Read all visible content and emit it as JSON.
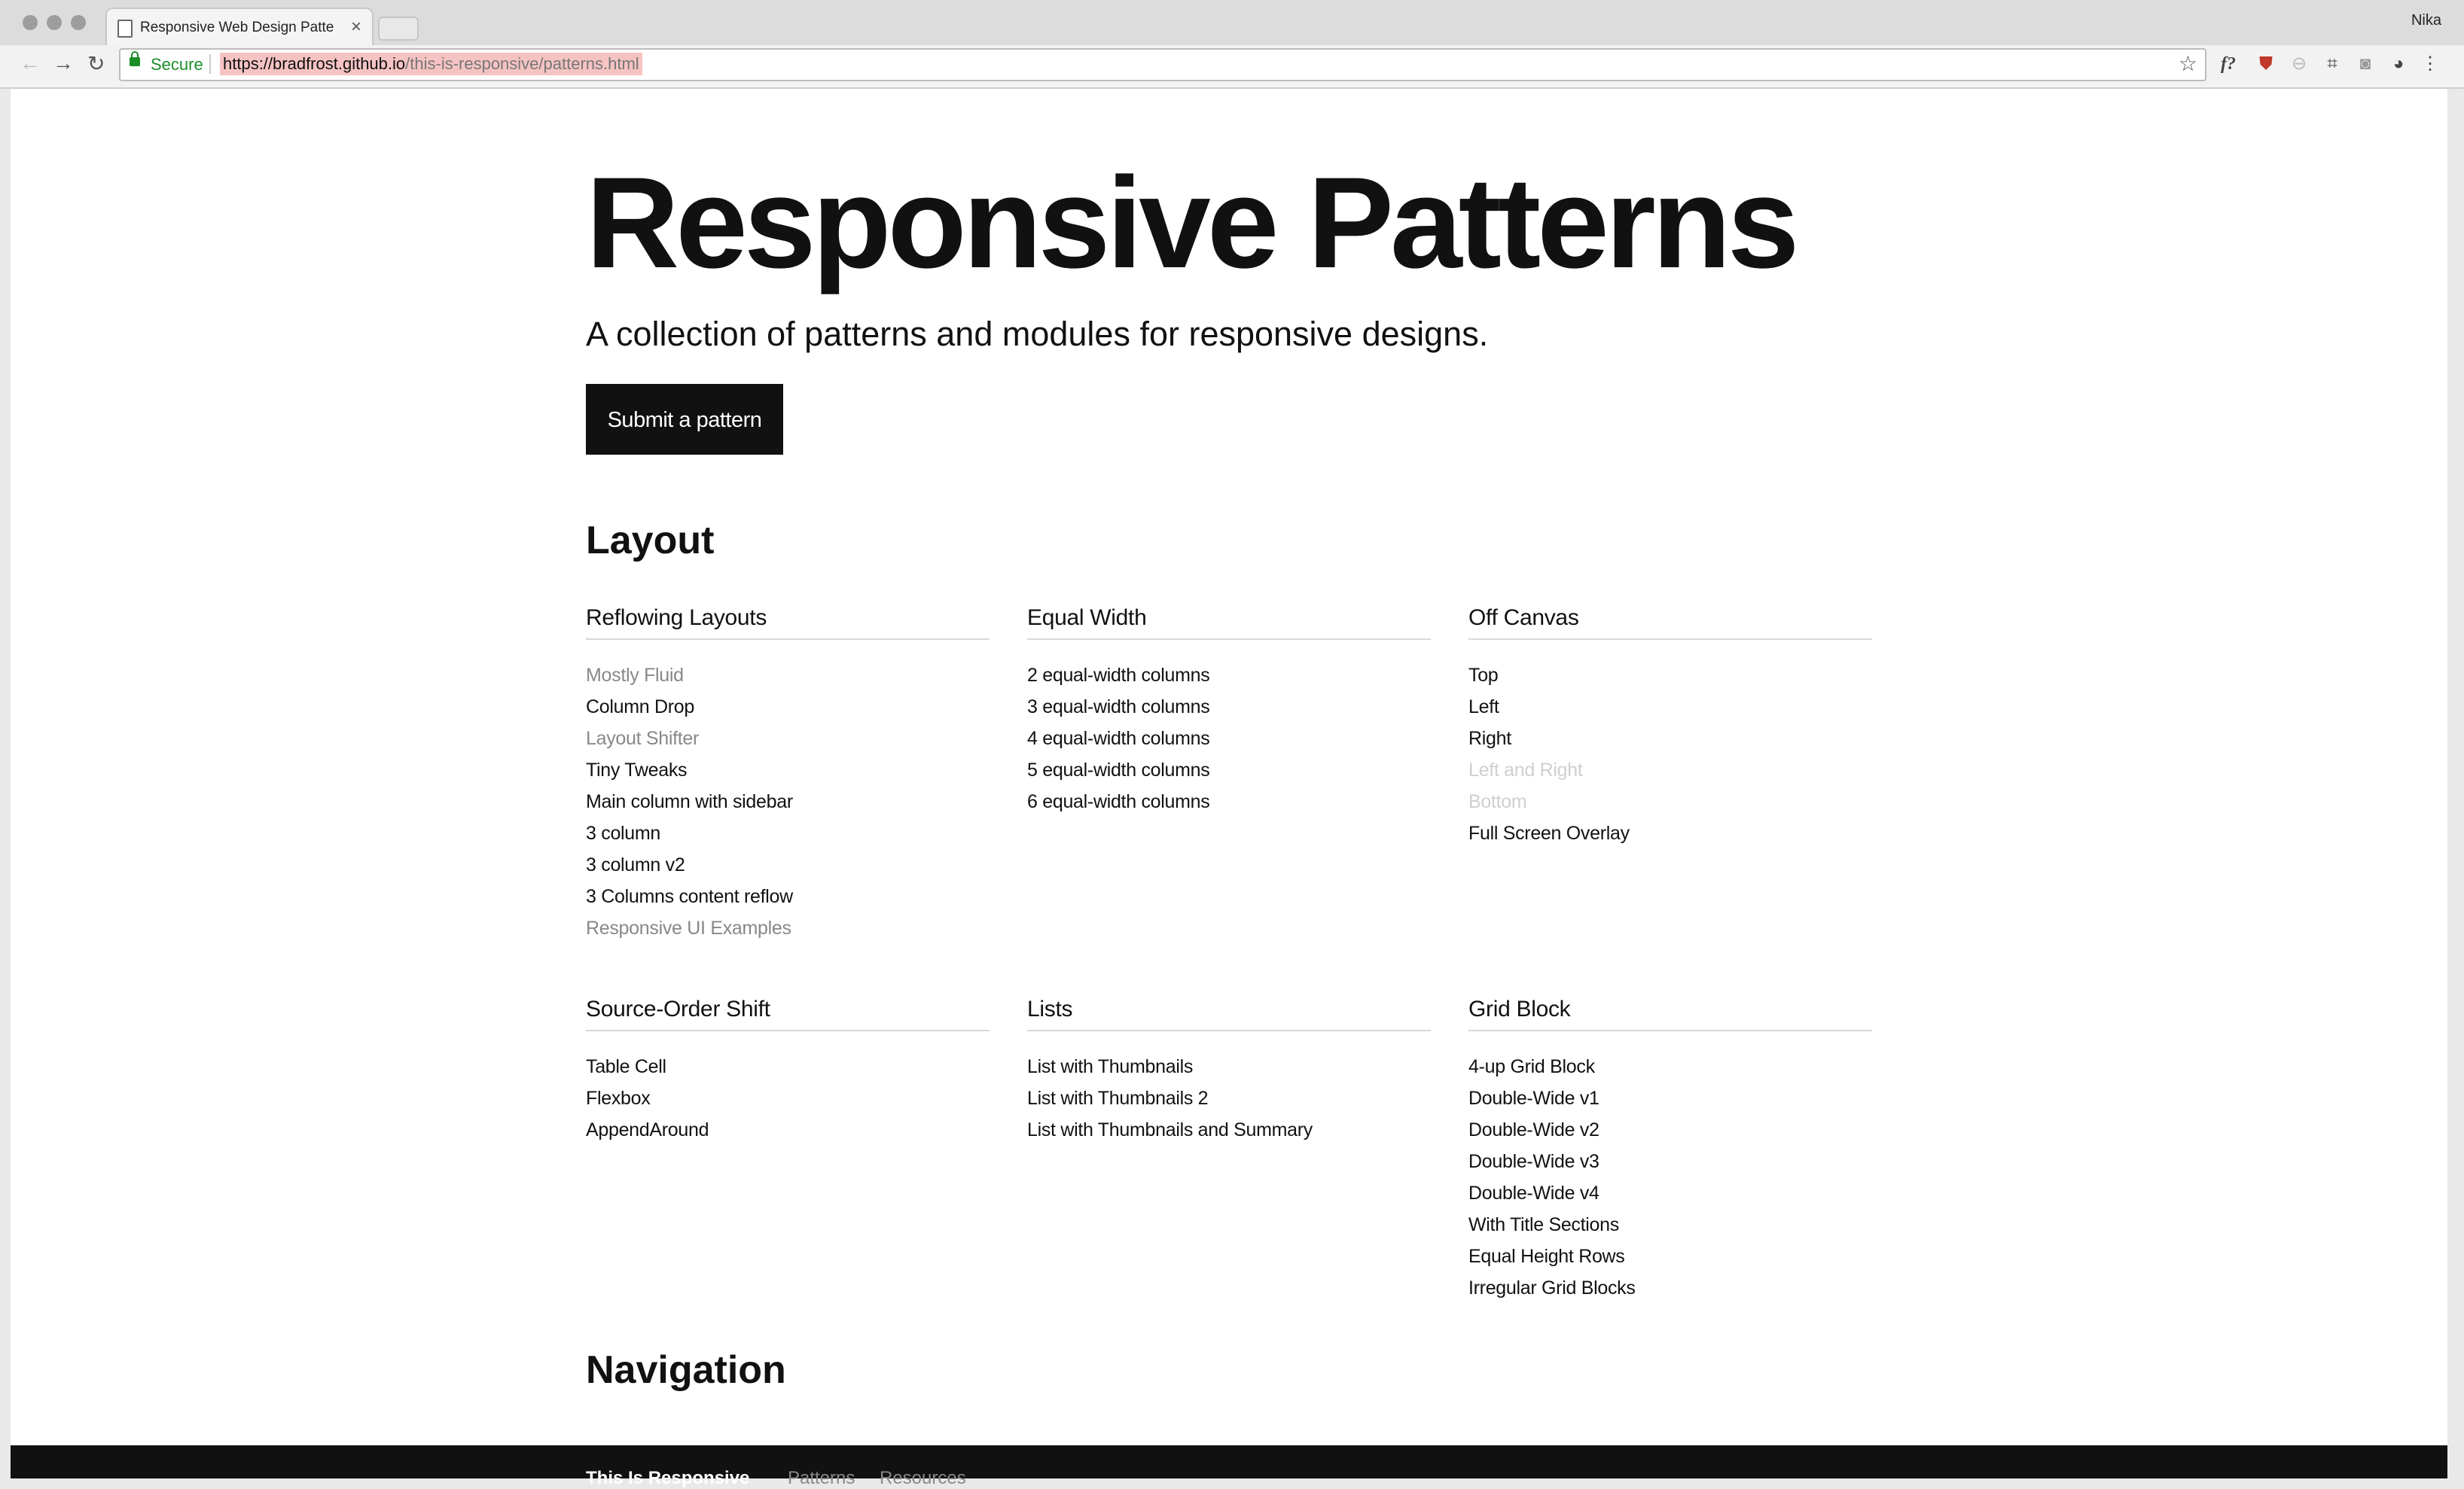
{
  "browser": {
    "tab_title": "Responsive Web Design Patte",
    "profile_name": "Nika",
    "secure_label": "Secure",
    "url_host": "https://bradfrost.github.io",
    "url_path": "/this-is-responsive/patterns.html",
    "icons": [
      "back-icon",
      "forward-icon",
      "reload-icon",
      "lock-icon",
      "star-icon",
      "fontface-ninja-icon",
      "extension-icon",
      "camera-icon",
      "chrome-icon",
      "more-icon"
    ]
  },
  "page": {
    "title": "Responsive Patterns",
    "subtitle": "A collection of patterns and modules for responsive designs.",
    "submit_label": "Submit a pattern",
    "sections": [
      {
        "heading": "Layout",
        "columns": [
          {
            "title": "Reflowing Layouts",
            "items": [
              "Mostly Fluid",
              "Column Drop",
              "Layout Shifter",
              "Tiny Tweaks",
              "Main column with sidebar",
              "3 column",
              "3 column v2",
              "3 Columns content reflow",
              "Responsive UI Examples"
            ]
          },
          {
            "title": "Equal Width",
            "items": [
              "2 equal-width columns",
              "3 equal-width columns",
              "4 equal-width columns",
              "5 equal-width columns",
              "6 equal-width columns"
            ]
          },
          {
            "title": "Off Canvas",
            "items": [
              "Top",
              "Left",
              "Right",
              "Left and Right",
              "Bottom",
              "Full Screen Overlay"
            ]
          },
          {
            "title": "Source-Order Shift",
            "items": [
              "Table Cell",
              "Flexbox",
              "AppendAround"
            ]
          },
          {
            "title": "Lists",
            "items": [
              "List with Thumbnails",
              "List with Thumbnails 2",
              "List with Thumbnails and Summary"
            ]
          },
          {
            "title": "Grid Block",
            "items": [
              "4-up Grid Block",
              "Double-Wide v1",
              "Double-Wide v2",
              "Double-Wide v3",
              "Double-Wide v4",
              "With Title Sections",
              "Equal Height Rows",
              "Irregular Grid Blocks"
            ]
          }
        ]
      },
      {
        "heading": "Navigation"
      }
    ]
  },
  "footer": {
    "brand": "This Is Responsive",
    "links": [
      "Patterns",
      "Resources"
    ]
  },
  "colors": {
    "accent": "#111111",
    "secure": "#1a8f28",
    "url_highlight": "#f6c3c3"
  }
}
